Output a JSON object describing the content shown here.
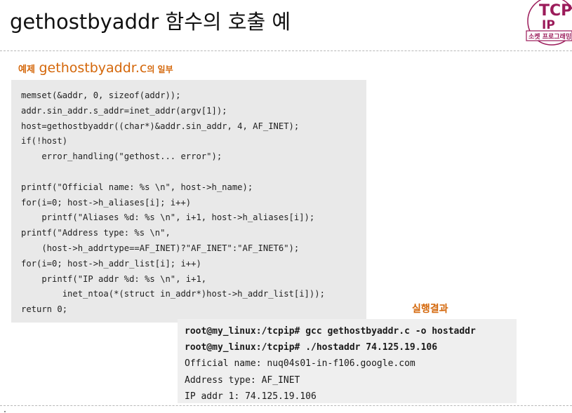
{
  "title": "gethostbyaddr 함수의 호출 예",
  "logo": {
    "line1": "TCP",
    "line2": "IP",
    "line3": "소켓 프로그래밍",
    "color": "#9b1b5a"
  },
  "example_label": {
    "prefix": "예제",
    "filename": "gethostbyaddr.c",
    "suffix": "의 일부"
  },
  "code_lines": [
    "memset(&addr, 0, sizeof(addr));",
    "addr.sin_addr.s_addr=inet_addr(argv[1]);",
    "host=gethostbyaddr((char*)&addr.sin_addr, 4, AF_INET);",
    "if(!host)",
    "    error_handling(\"gethost... error\");",
    "",
    "printf(\"Official name: %s \\n\", host->h_name);",
    "for(i=0; host->h_aliases[i]; i++)",
    "    printf(\"Aliases %d: %s \\n\", i+1, host->h_aliases[i]);",
    "printf(\"Address type: %s \\n\",",
    "    (host->h_addrtype==AF_INET)?\"AF_INET\":\"AF_INET6\");",
    "for(i=0; host->h_addr_list[i]; i++)",
    "    printf(\"IP addr %d: %s \\n\", i+1,",
    "        inet_ntoa(*(struct in_addr*)host->h_addr_list[i]));",
    "return 0;"
  ],
  "result_label": "실행결과",
  "terminal": {
    "prompt": "root@my_linux:/tcpip#",
    "cmd1": "gcc gethostbyaddr.c -o hostaddr",
    "cmd2": "./hostaddr 74.125.19.106",
    "out1": "Official name: nuq04s01-in-f106.google.com",
    "out2": "Address type: AF_INET",
    "out3": "IP addr 1: 74.125.19.106"
  },
  "colors": {
    "accent": "#d4670a",
    "code_bg": "#e9e9e9",
    "terminal_bg": "#efefef"
  }
}
